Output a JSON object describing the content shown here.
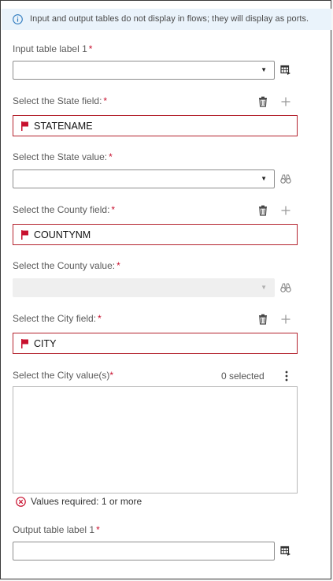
{
  "banner": {
    "text": "Input and output tables do not display in flows; they will display as ports.",
    "icon": "info-icon"
  },
  "input_table": {
    "label": "Input table label 1",
    "required_mark": "*",
    "value": "",
    "icon": "table-select-icon"
  },
  "state_field": {
    "label": "Select the State field:",
    "required_mark": "*",
    "value": "STATENAME",
    "icons": [
      "trash-icon",
      "plus-icon"
    ]
  },
  "state_value": {
    "label": "Select the State value:",
    "required_mark": "*",
    "value": "",
    "icon": "binoculars-icon"
  },
  "county_field": {
    "label": "Select the County field:",
    "required_mark": "*",
    "value": "COUNTYNM",
    "icons": [
      "trash-icon",
      "plus-icon"
    ]
  },
  "county_value": {
    "label": "Select the County value:",
    "required_mark": "*",
    "value": "",
    "disabled": true,
    "icon": "binoculars-icon"
  },
  "city_field": {
    "label": "Select the City field:",
    "required_mark": "*",
    "value": "CITY",
    "icons": [
      "trash-icon",
      "plus-icon"
    ]
  },
  "city_values": {
    "label": "Select the City value(s)",
    "required_mark": "*",
    "selected_count": "0 selected",
    "items": []
  },
  "validation": {
    "message": "Values required: 1 or more",
    "icon": "error-circle-icon"
  },
  "output_table": {
    "label": "Output table label 1",
    "required_mark": "*",
    "value": "",
    "icon": "table-output-icon"
  },
  "colors": {
    "error_border": "#b4232e",
    "required": "#c8102e",
    "banner_bg": "#eaf3fb",
    "info_blue": "#2f7bbf"
  }
}
